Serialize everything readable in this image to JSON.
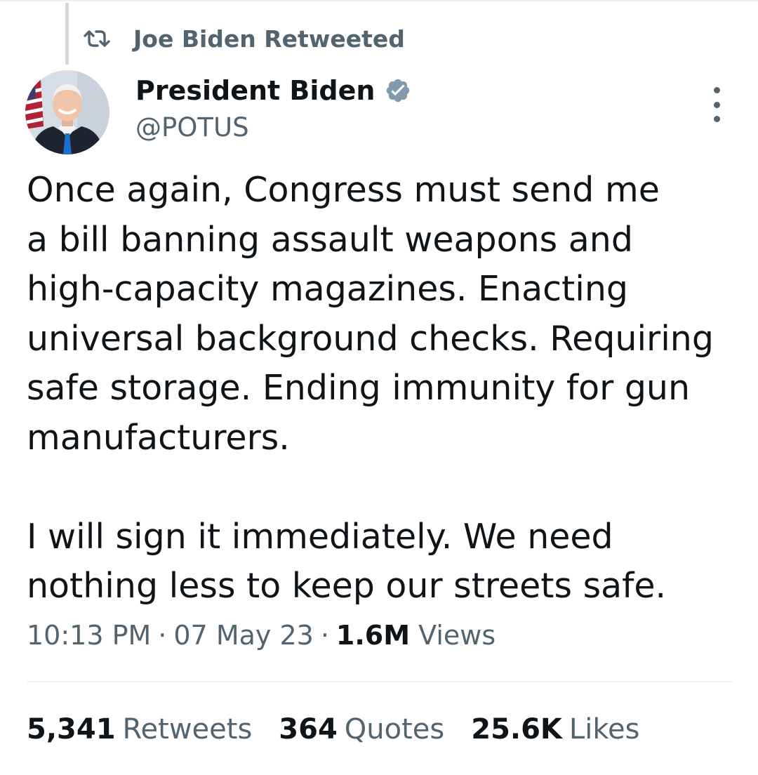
{
  "retweet_header": {
    "icon": "retweet-icon",
    "text": "Joe Biden Retweeted"
  },
  "author": {
    "display_name": "President Biden",
    "handle": "@POTUS",
    "verified_icon": "verified-badge-icon",
    "verified_color": "#829aab"
  },
  "tweet": {
    "text": "Once again, Congress must send me\na bill banning assault weapons and\nhigh-capacity magazines. Enacting\nuniversal background checks. Requiring\nsafe storage. Ending immunity for gun\nmanufacturers.\n\nI will sign it immediately. We need\nnothing less to keep our streets safe."
  },
  "meta": {
    "time": "10:13 PM",
    "separator": "·",
    "date": "07 May 23",
    "views_count": "1.6M",
    "views_label": "Views"
  },
  "stats": [
    {
      "count": "5,341",
      "label": "Retweets"
    },
    {
      "count": "364",
      "label": "Quotes"
    },
    {
      "count": "25.6K",
      "label": "Likes"
    }
  ],
  "colors": {
    "text_primary": "#0f1419",
    "text_secondary": "#536471",
    "divider": "#eff3f4"
  }
}
